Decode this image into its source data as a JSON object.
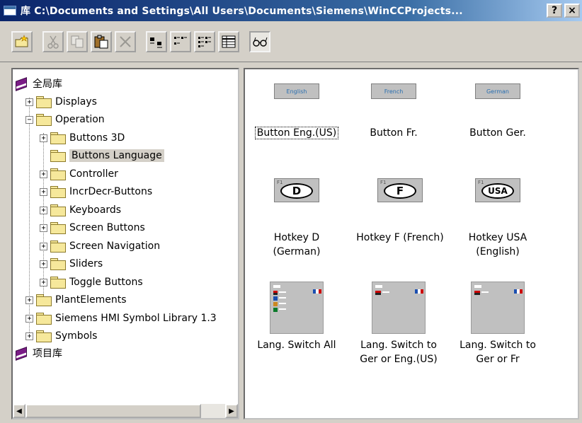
{
  "window": {
    "title_char": "库",
    "title_path": "C:\\Documents and Settings\\All Users\\Documents\\Siemens\\WinCCProjects...",
    "help_label": "?",
    "close_label": "×"
  },
  "toolbar": {
    "buttons": [
      {
        "name": "new-folder-icon",
        "enabled": true
      },
      {
        "name": "cut-icon",
        "enabled": false
      },
      {
        "name": "copy-icon",
        "enabled": false
      },
      {
        "name": "paste-icon",
        "enabled": true
      },
      {
        "name": "delete-icon",
        "enabled": false
      },
      {
        "name": "large-icons-view-icon",
        "enabled": true
      },
      {
        "name": "small-icons-view-icon",
        "enabled": true
      },
      {
        "name": "list-view-icon",
        "enabled": true
      },
      {
        "name": "details-view-icon",
        "enabled": true
      },
      {
        "name": "preview-glasses-icon",
        "enabled": true,
        "pressed": true
      }
    ]
  },
  "tree": {
    "global_library": "全局库",
    "project_library": "项目库",
    "nodes": [
      {
        "label": "Displays",
        "expander": "+"
      },
      {
        "label": "Operation",
        "expander": "−"
      },
      {
        "label": "Buttons 3D",
        "expander": "+"
      },
      {
        "label": "Buttons Language",
        "expander": ""
      },
      {
        "label": "Controller",
        "expander": "+"
      },
      {
        "label": "IncrDecr-Buttons",
        "expander": "+"
      },
      {
        "label": "Keyboards",
        "expander": "+"
      },
      {
        "label": "Screen Buttons",
        "expander": "+"
      },
      {
        "label": "Screen Navigation",
        "expander": "+"
      },
      {
        "label": "Sliders",
        "expander": "+"
      },
      {
        "label": "Toggle Buttons",
        "expander": "+"
      },
      {
        "label": "PlantElements",
        "expander": "+"
      },
      {
        "label": "Siemens HMI Symbol Library 1.3",
        "expander": "+"
      },
      {
        "label": "Symbols",
        "expander": "+"
      }
    ]
  },
  "items": {
    "btn_eng": {
      "thumb": "English",
      "caption": "Button Eng.(US)"
    },
    "btn_fr": {
      "thumb": "French",
      "caption": "Button Fr."
    },
    "btn_ger": {
      "thumb": "German",
      "caption": "Button Ger."
    },
    "hk_d": {
      "fkey": "F1",
      "key": "D",
      "caption1": "Hotkey D",
      "caption2": "(German)"
    },
    "hk_f": {
      "fkey": "F1",
      "key": "F",
      "caption1": "Hotkey F (French)",
      "caption2": ""
    },
    "hk_usa": {
      "fkey": "F1",
      "key": "USA",
      "caption1": "Hotkey USA",
      "caption2": "(English)"
    },
    "ls_all": {
      "caption1": "Lang. Switch All",
      "caption2": ""
    },
    "ls_eng": {
      "caption1": "Lang. Switch to",
      "caption2": "Ger or Eng.(US)"
    },
    "ls_fr": {
      "caption1": "Lang. Switch to",
      "caption2": "Ger or Fr"
    }
  },
  "scrollbar": {
    "left_arrow": "◀",
    "right_arrow": "▶"
  }
}
